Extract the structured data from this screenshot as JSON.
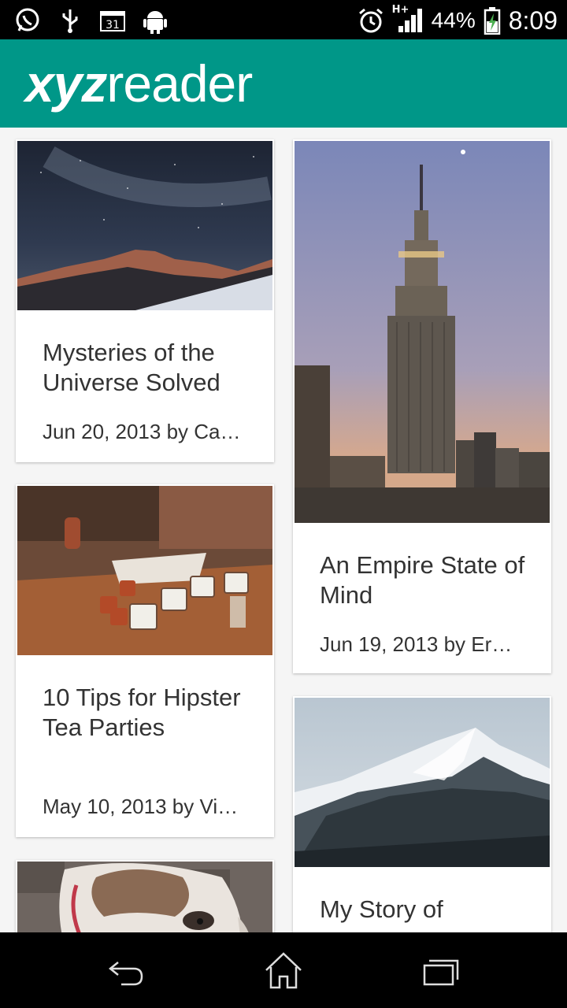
{
  "status_bar": {
    "battery_percent": "44%",
    "time": "8:09",
    "calendar_day": "31",
    "network": "H+"
  },
  "app": {
    "logo_bold": "xyz",
    "logo_regular": "reader",
    "accent_color": "#009788"
  },
  "articles": [
    {
      "title": "Mysteries of the Universe Solved",
      "meta": "Jun 20, 2013 by Ca…",
      "image": "starry-mountain-night"
    },
    {
      "title": "An Empire State of Mind",
      "meta": "Jun 19, 2013 by Er…",
      "image": "empire-state-building"
    },
    {
      "title": "10 Tips for Hipster Tea Parties",
      "meta": "May 10, 2013 by Vi…",
      "image": "tea-cups-table"
    },
    {
      "title": "My Story of",
      "meta": "",
      "image": "snowy-mountain"
    },
    {
      "title": "",
      "meta": "",
      "image": "bulldog"
    }
  ],
  "nav": {
    "back": "back-icon",
    "home": "home-icon",
    "recents": "recents-icon"
  }
}
